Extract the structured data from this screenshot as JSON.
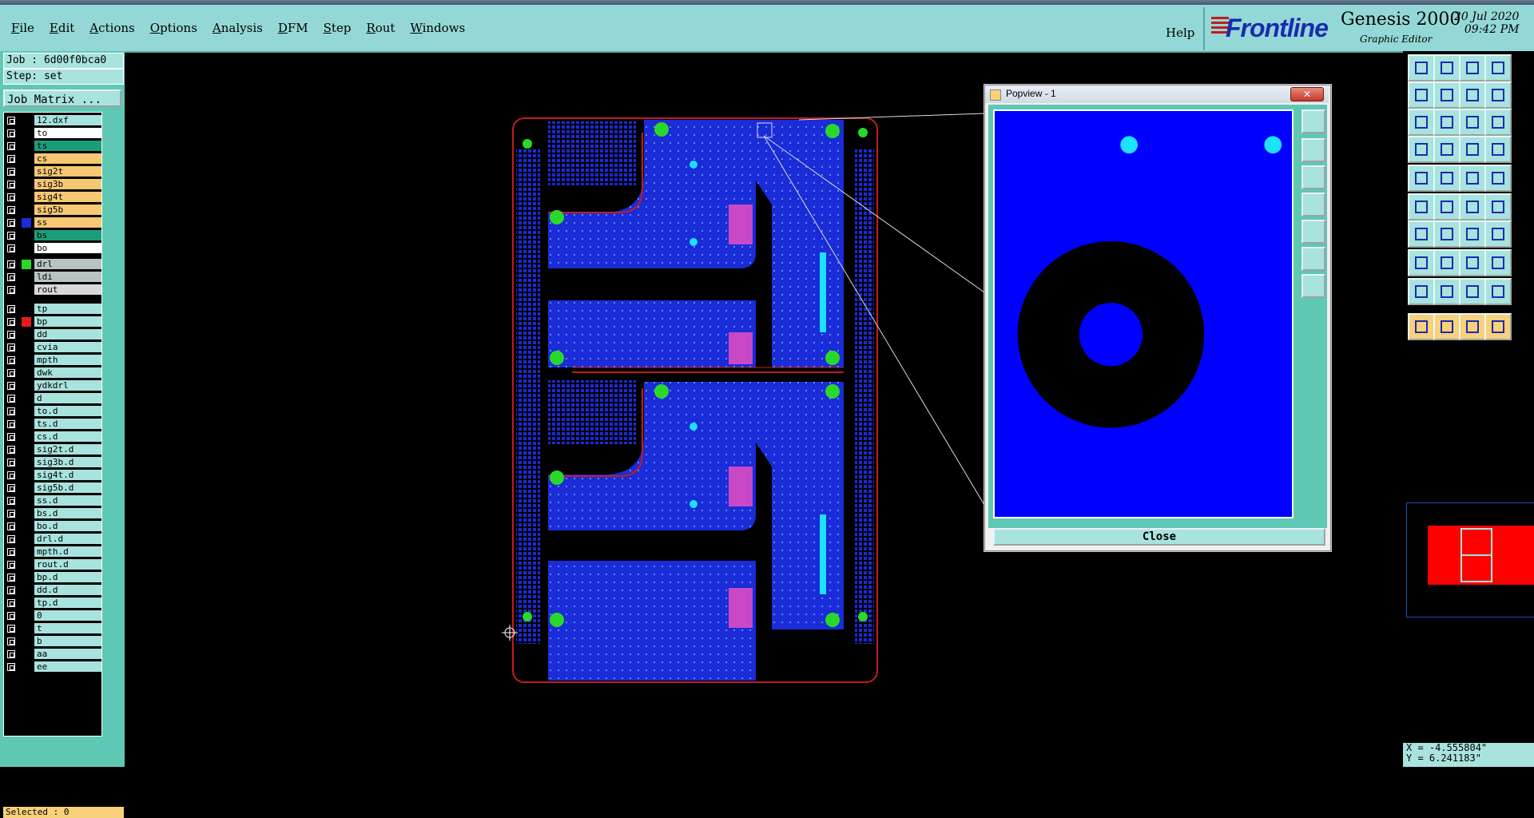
{
  "menu": [
    "File",
    "Edit",
    "Actions",
    "Options",
    "Analysis",
    "DFM",
    "Step",
    "Rout",
    "Windows"
  ],
  "help": "Help",
  "brand": {
    "logo": "Frontline",
    "product": "Genesis 2000",
    "subtitle": "Graphic Editor",
    "date": "20 Jul 2020",
    "time": "09:42 PM"
  },
  "job": {
    "job_label": "Job : 6d00f0bca0",
    "step_label": "Step: set",
    "matrix_button": "Job Matrix ..."
  },
  "layers": [
    {
      "name": "12.dxf",
      "color": "#a8e3de",
      "swatch": "#000000"
    },
    {
      "name": "to",
      "color": "#ffffff",
      "swatch": "#000000"
    },
    {
      "name": "ts",
      "color": "#1a9e7a",
      "swatch": "#000000"
    },
    {
      "name": "cs",
      "color": "#f8c774",
      "swatch": "#000000"
    },
    {
      "name": "sig2t",
      "color": "#f8c774",
      "swatch": "#000000"
    },
    {
      "name": "sig3b",
      "color": "#f8c774",
      "swatch": "#000000"
    },
    {
      "name": "sig4t",
      "color": "#f8c774",
      "swatch": "#000000"
    },
    {
      "name": "sig5b",
      "color": "#f8c774",
      "swatch": "#000000"
    },
    {
      "name": "ss",
      "color": "#f8c774",
      "swatch": "#1a2bd8"
    },
    {
      "name": "bs",
      "color": "#1a9e7a",
      "swatch": "#000000"
    },
    {
      "name": "bo",
      "color": "#ffffff",
      "swatch": "#000000"
    },
    {
      "name": "drl",
      "color": "#b8c4c4",
      "swatch": "#2ad82a"
    },
    {
      "name": "ldi",
      "color": "#b8c4c4",
      "swatch": "#000000"
    },
    {
      "name": "rout",
      "color": "#d8d8d8",
      "swatch": "#000000"
    },
    {
      "name": "tp",
      "color": "#a8e3de",
      "swatch": "#000000"
    },
    {
      "name": "bp",
      "color": "#a8e3de",
      "swatch": "#e81a1a"
    },
    {
      "name": "dd",
      "color": "#a8e3de",
      "swatch": "#000000"
    },
    {
      "name": "cvia",
      "color": "#a8e3de",
      "swatch": "#000000"
    },
    {
      "name": "mpth",
      "color": "#a8e3de",
      "swatch": "#000000"
    },
    {
      "name": "dwk",
      "color": "#a8e3de",
      "swatch": "#000000"
    },
    {
      "name": "ydkdrl",
      "color": "#a8e3de",
      "swatch": "#000000"
    },
    {
      "name": "d",
      "color": "#a8e3de",
      "swatch": "#000000"
    },
    {
      "name": "to.d",
      "color": "#a8e3de",
      "swatch": "#000000"
    },
    {
      "name": "ts.d",
      "color": "#a8e3de",
      "swatch": "#000000"
    },
    {
      "name": "cs.d",
      "color": "#a8e3de",
      "swatch": "#000000"
    },
    {
      "name": "sig2t.d",
      "color": "#a8e3de",
      "swatch": "#000000"
    },
    {
      "name": "sig3b.d",
      "color": "#a8e3de",
      "swatch": "#000000"
    },
    {
      "name": "sig4t.d",
      "color": "#a8e3de",
      "swatch": "#000000"
    },
    {
      "name": "sig5b.d",
      "color": "#a8e3de",
      "swatch": "#000000"
    },
    {
      "name": "ss.d",
      "color": "#a8e3de",
      "swatch": "#000000"
    },
    {
      "name": "bs.d",
      "color": "#a8e3de",
      "swatch": "#000000"
    },
    {
      "name": "bo.d",
      "color": "#a8e3de",
      "swatch": "#000000"
    },
    {
      "name": "drl.d",
      "color": "#a8e3de",
      "swatch": "#000000"
    },
    {
      "name": "mpth.d",
      "color": "#a8e3de",
      "swatch": "#000000"
    },
    {
      "name": "rout.d",
      "color": "#a8e3de",
      "swatch": "#000000"
    },
    {
      "name": "bp.d",
      "color": "#a8e3de",
      "swatch": "#000000"
    },
    {
      "name": "dd.d",
      "color": "#a8e3de",
      "swatch": "#000000"
    },
    {
      "name": "tp.d",
      "color": "#a8e3de",
      "swatch": "#000000"
    },
    {
      "name": "0",
      "color": "#a8e3de",
      "swatch": "#000000"
    },
    {
      "name": "t",
      "color": "#a8e3de",
      "swatch": "#000000"
    },
    {
      "name": "b",
      "color": "#a8e3de",
      "swatch": "#000000"
    },
    {
      "name": "aa",
      "color": "#a8e3de",
      "swatch": "#000000"
    },
    {
      "name": "ee",
      "color": "#a8e3de",
      "swatch": "#000000"
    }
  ],
  "status": {
    "selected": "Selected : 0"
  },
  "popview": {
    "title": "Popview - 1",
    "close_label": "Close"
  },
  "coords": {
    "x": "X = -4.555804\"",
    "y": "Y = 6.241183\""
  },
  "colors": {
    "panel": "#5fc8b4",
    "button": "#a8e3de",
    "copper": "#1a2bd8",
    "pad": "#2ad82a",
    "outline": "#c21d1d",
    "mini_red": "#ff0000"
  }
}
